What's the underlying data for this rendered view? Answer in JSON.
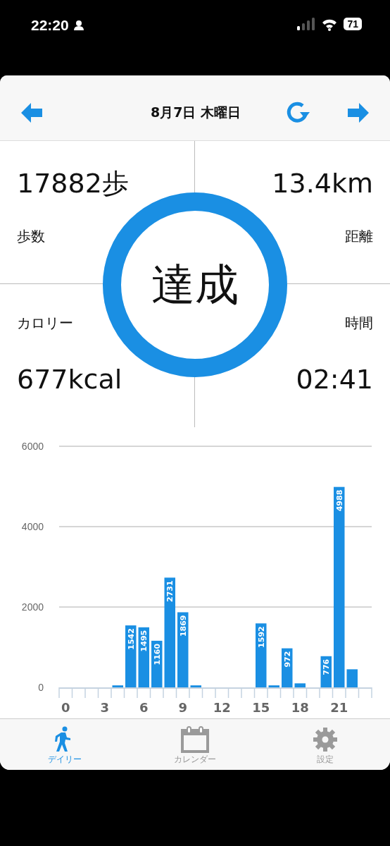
{
  "status_bar": {
    "time": "22:20",
    "battery": "71"
  },
  "header": {
    "date": "8月7日 木曜日"
  },
  "stats": [
    {
      "label": "歩数",
      "value": "17882歩"
    },
    {
      "label": "距離",
      "value": "13.4km"
    },
    {
      "label": "カロリー",
      "value": "677kcal"
    },
    {
      "label": "時間",
      "value": "02:41"
    }
  ],
  "goal_ring": {
    "text": "達成",
    "level": 1
  },
  "chart_data": {
    "type": "bar",
    "x": [
      0,
      1,
      2,
      3,
      4,
      5,
      6,
      7,
      8,
      9,
      10,
      11,
      12,
      13,
      14,
      15,
      16,
      17,
      18,
      19,
      20,
      21,
      22,
      23
    ],
    "series": [
      {
        "color": "#1a8fe3",
        "values": [
          0,
          0,
          0,
          0,
          50,
          1542,
          1495,
          1160,
          2731,
          1869,
          50,
          0,
          0,
          0,
          0,
          1592,
          50,
          972,
          100,
          0,
          776,
          4988,
          450,
          0
        ]
      }
    ],
    "value_labels": [
      null,
      null,
      null,
      null,
      null,
      "1542",
      "1495",
      "1160",
      "2731",
      "1869",
      null,
      null,
      null,
      null,
      null,
      "1592",
      null,
      "972",
      null,
      null,
      "776",
      "4988",
      null,
      null
    ],
    "xlim": [
      -0.5,
      23.5
    ],
    "xticks": [
      0,
      3,
      6,
      9,
      12,
      15,
      18,
      21
    ],
    "ylim": [
      0,
      6000
    ],
    "yticks": [
      0,
      2000,
      4000,
      6000
    ]
  },
  "tabs": [
    {
      "label": "デイリー",
      "selected": true
    },
    {
      "label": "カレンダー",
      "selected": false
    },
    {
      "label": "設定",
      "selected": false
    }
  ]
}
